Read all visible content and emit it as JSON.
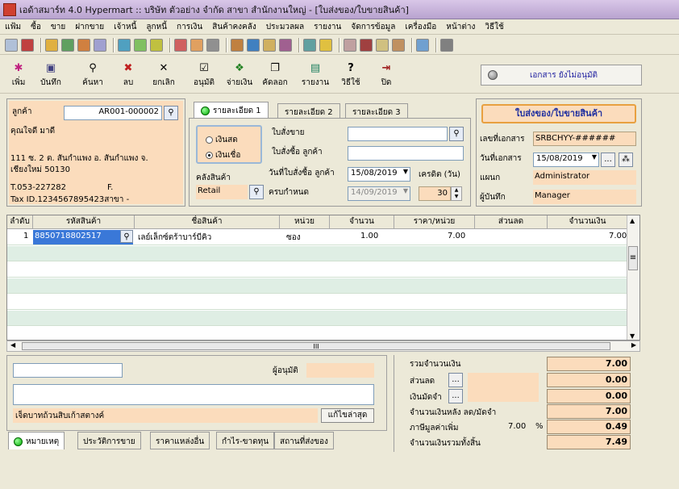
{
  "window": {
    "title": "เอด้าสมาร์ท 4.0 Hypermart :: บริษัท ตัวอย่าง จำกัด สาขา สำนักงานใหญ่ - [ใบส่งของ/ใบขายสินค้า]"
  },
  "menu": [
    "แฟ้ม",
    "ซื้อ",
    "ขาย",
    "ฝากขาย",
    "เจ้าหนี้",
    "ลูกหนี้",
    "การเงิน",
    "สินค้าคงคลัง",
    "ประมวลผล",
    "รายงาน",
    "จัดการข้อมูล",
    "เครื่องมือ",
    "หน้าต่าง",
    "วิธีใช้"
  ],
  "toolbar": {
    "save": "บันทึก",
    "add": "เพิ่ม",
    "find": "ค้นหา",
    "delete": "ลบ",
    "cancel": "ยกเลิก",
    "approve": "อนุมัติ",
    "pay": "จ่ายเงิน",
    "copy": "คัดลอก",
    "report": "รายงาน",
    "help": "วิธีใช้",
    "close": "ปิด"
  },
  "doc_status": "เอกสาร ยังไม่อนุมัติ",
  "customer": {
    "label": "ลูกค้า",
    "code": "AR001-000002",
    "name": "คุณใจดี มาดี",
    "addr1": "111  ซ. 2  ต. สันกำแพง อ. สันกำแพง จ.",
    "addr2": "เชียงใหม่  50130",
    "phone": "T.053-227282",
    "fax": "F.",
    "tax": "Tax ID.1234567895423สาขา -"
  },
  "tabs": [
    "รายละเอียด 1",
    "รายละเอียด 2",
    "รายละเอียด 3"
  ],
  "payment": {
    "cash": "เงินสด",
    "credit": "เงินเชื่อ"
  },
  "detail": {
    "so_label": "ใบสั่งขาย",
    "po_label": "ใบสั่งซื้อ ลูกค้า",
    "po_date_label": "วันที่ใบสั่งซื้อ ลูกค้า",
    "po_date": "15/08/2019",
    "credit_label": "เครดิต (วัน)",
    "credit_days": "30",
    "wh_label": "คลังสินค้า",
    "warehouse": "Retail",
    "due_label": "ครบกำหนด",
    "due_date": "14/09/2019"
  },
  "doc": {
    "heading": "ใบส่งของ/ใบขายสินค้า",
    "no_label": "เลขที่เอกสาร",
    "no": "SRBCHYY-######",
    "date_label": "วันที่เอกสาร",
    "date": "15/08/2019",
    "dept_label": "แผนก",
    "dept": "Administrator",
    "rec_label": "ผู้บันทึก",
    "recorder": "Manager"
  },
  "grid": {
    "headers": [
      "ลำดับ",
      "รหัสสินค้า",
      "ชื่อสินค้า",
      "หน่วย",
      "จำนวน",
      "ราคา/หน่วย",
      "ส่วนลด",
      "จำนวนเงิน"
    ],
    "rows": [
      {
        "no": "1",
        "code": "8850718802517",
        "name": "เลย์เล็กซ์ตร้าบาร์บีคิว",
        "unit": "ซอง",
        "qty": "1.00",
        "price": "7.00",
        "discount": "",
        "amount": "7.00"
      }
    ],
    "hscroll_label": "III"
  },
  "approver_label": "ผู้อนุมัติ",
  "amount_text": "เจ็ดบาทถ้วน",
  "amount_text_suffix": "สิบเก้าสตางค์",
  "fix_button": "แก้ไขล่าสุด",
  "bottom_tabs": [
    "หมายเหตุ",
    "ประวัติการขาย",
    "ราคาแหล่งอื่น",
    "กำไร-ขาดทุน",
    "สถานที่ส่งของ"
  ],
  "summary": {
    "total_label": "รวมจำนวนเงิน",
    "total": "7.00",
    "disc_label": "ส่วนลด",
    "disc": "0.00",
    "deposit_label": "เงินมัดจำ",
    "deposit": "0.00",
    "after_label": "จำนวนเงินหลัง ลด/มัดจำ",
    "after": "7.00",
    "vat_label": "ภาษีมูลค่าเพิ่ม",
    "vat_rate": "7.00",
    "vat_pct": "%",
    "vat": "0.49",
    "grand_label": "จำนวนเงินรวมทั้งสิ้น",
    "grand": "7.49"
  }
}
